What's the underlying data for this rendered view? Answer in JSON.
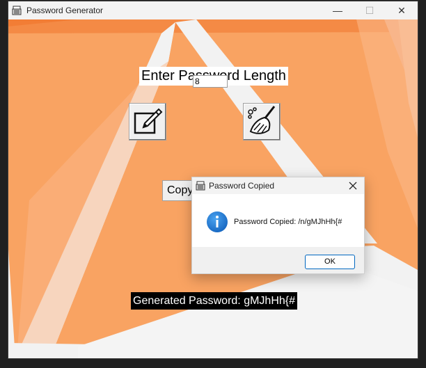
{
  "window": {
    "title": "Password Generator",
    "minimize_glyph": "—",
    "maximize_glyph": "☐",
    "close_glyph": "✕"
  },
  "main": {
    "length_label": "Enter Password Length",
    "length_value": "8",
    "generate_button_icon": "edit-icon",
    "clear_button_icon": "broom-icon",
    "copy_button_label": "Copy",
    "generated_label": "Generated Password: gMJhHh{#"
  },
  "dialog": {
    "title": "Password Copied",
    "icon": "info-icon",
    "message": "Password Copied: /n/gMJhHh{#",
    "ok_label": "OK"
  },
  "colors": {
    "background_orange": "#f9a362",
    "dialog_accent": "#0067c0",
    "info_blue": "#1a75d1"
  }
}
